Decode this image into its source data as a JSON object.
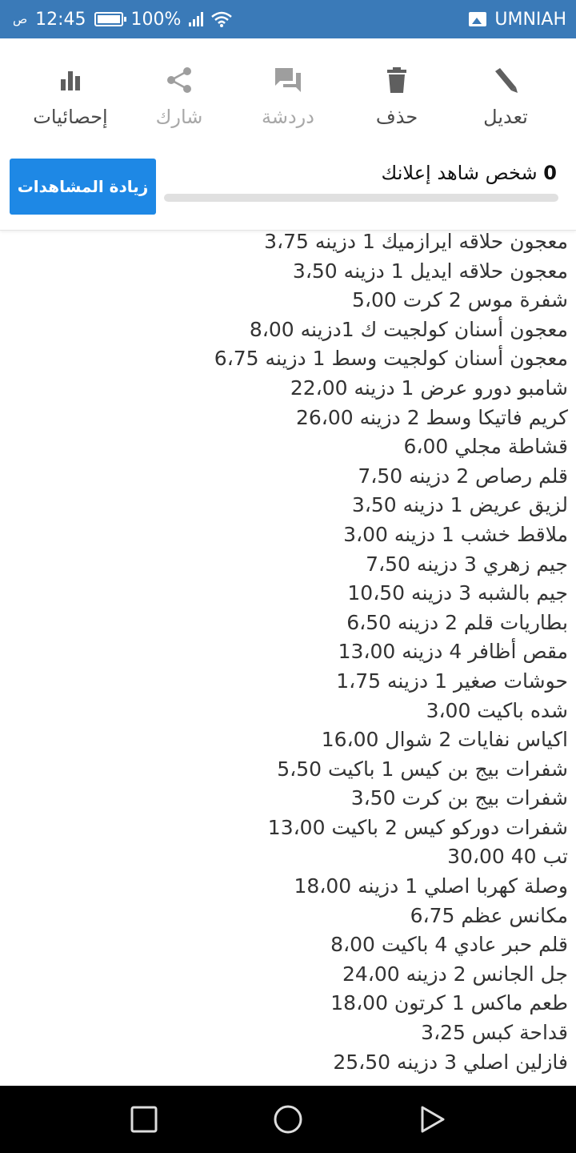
{
  "status_bar": {
    "time": "12:45",
    "ampm": "ص",
    "battery": "100%",
    "carrier": "UMNIAH"
  },
  "actions": [
    {
      "label": "تعديل",
      "icon": "pencil-icon",
      "enabled": true
    },
    {
      "label": "حذف",
      "icon": "trash-icon",
      "enabled": true
    },
    {
      "label": "دردشة",
      "icon": "chat-icon",
      "enabled": false
    },
    {
      "label": "شارك",
      "icon": "share-icon",
      "enabled": false
    },
    {
      "label": "إحصائيات",
      "icon": "stats-icon",
      "enabled": true
    }
  ],
  "viewers": {
    "count": "0",
    "text": "شخص شاهد إعلانك",
    "boost_label": "زيادة المشاهدات",
    "progress": 0
  },
  "items": [
    "معجون حلاقه ايرازميك 1 دزينه 3،75",
    "معجون حلاقه ايديل 1 دزينه 3،50",
    "شفرة موس 2 كرت 5،00",
    "معجون أسنان كولجيت ك 1دزينه 8،00",
    "معجون أسنان كولجيت وسط 1 دزينه 6،75",
    "شامبو دورو عرض 1 دزينه 22،00",
    "كريم فاتيكا وسط 2 دزينه 26،00",
    "قشاطة مجلي 6،00",
    "قلم رصاص 2 دزينه 7،50",
    "لزيق عريض 1 دزينه 3،50",
    "ملاقط خشب 1 دزينه 3،00",
    "جيم زهري 3 دزينه 7،50",
    "جيم بالشبه 3 دزينه 10،50",
    "بطاريات قلم 2 دزينه 6،50",
    "مقص أظافر 4 دزينه 13،00",
    "حوشات صغير 1 دزينه 1،75",
    "شده باكيت 3،00",
    "اكياس نفايات 2 شوال 16،00",
    "شفرات بيج بن كيس 1 باكيت 5،50",
    "شفرات بيج بن كرت 3،50",
    "شفرات دوركو كيس 2 باكيت 13،00",
    "تب 40 30،00",
    "وصلة كهربا اصلي 1 دزينه 18،00",
    "مكانس عظم 6،75",
    "قلم حبر عادي 4 باكيت 8،00",
    "جل الجانس 2 دزينه 24،00",
    "طعم ماكس 1 كرتون 18،00",
    "قداحة كبس 3،25",
    "فازلين اصلي 3 دزينه 25،50"
  ],
  "colors": {
    "status_bar": "#3a7ab8",
    "accent": "#1e88e5"
  }
}
